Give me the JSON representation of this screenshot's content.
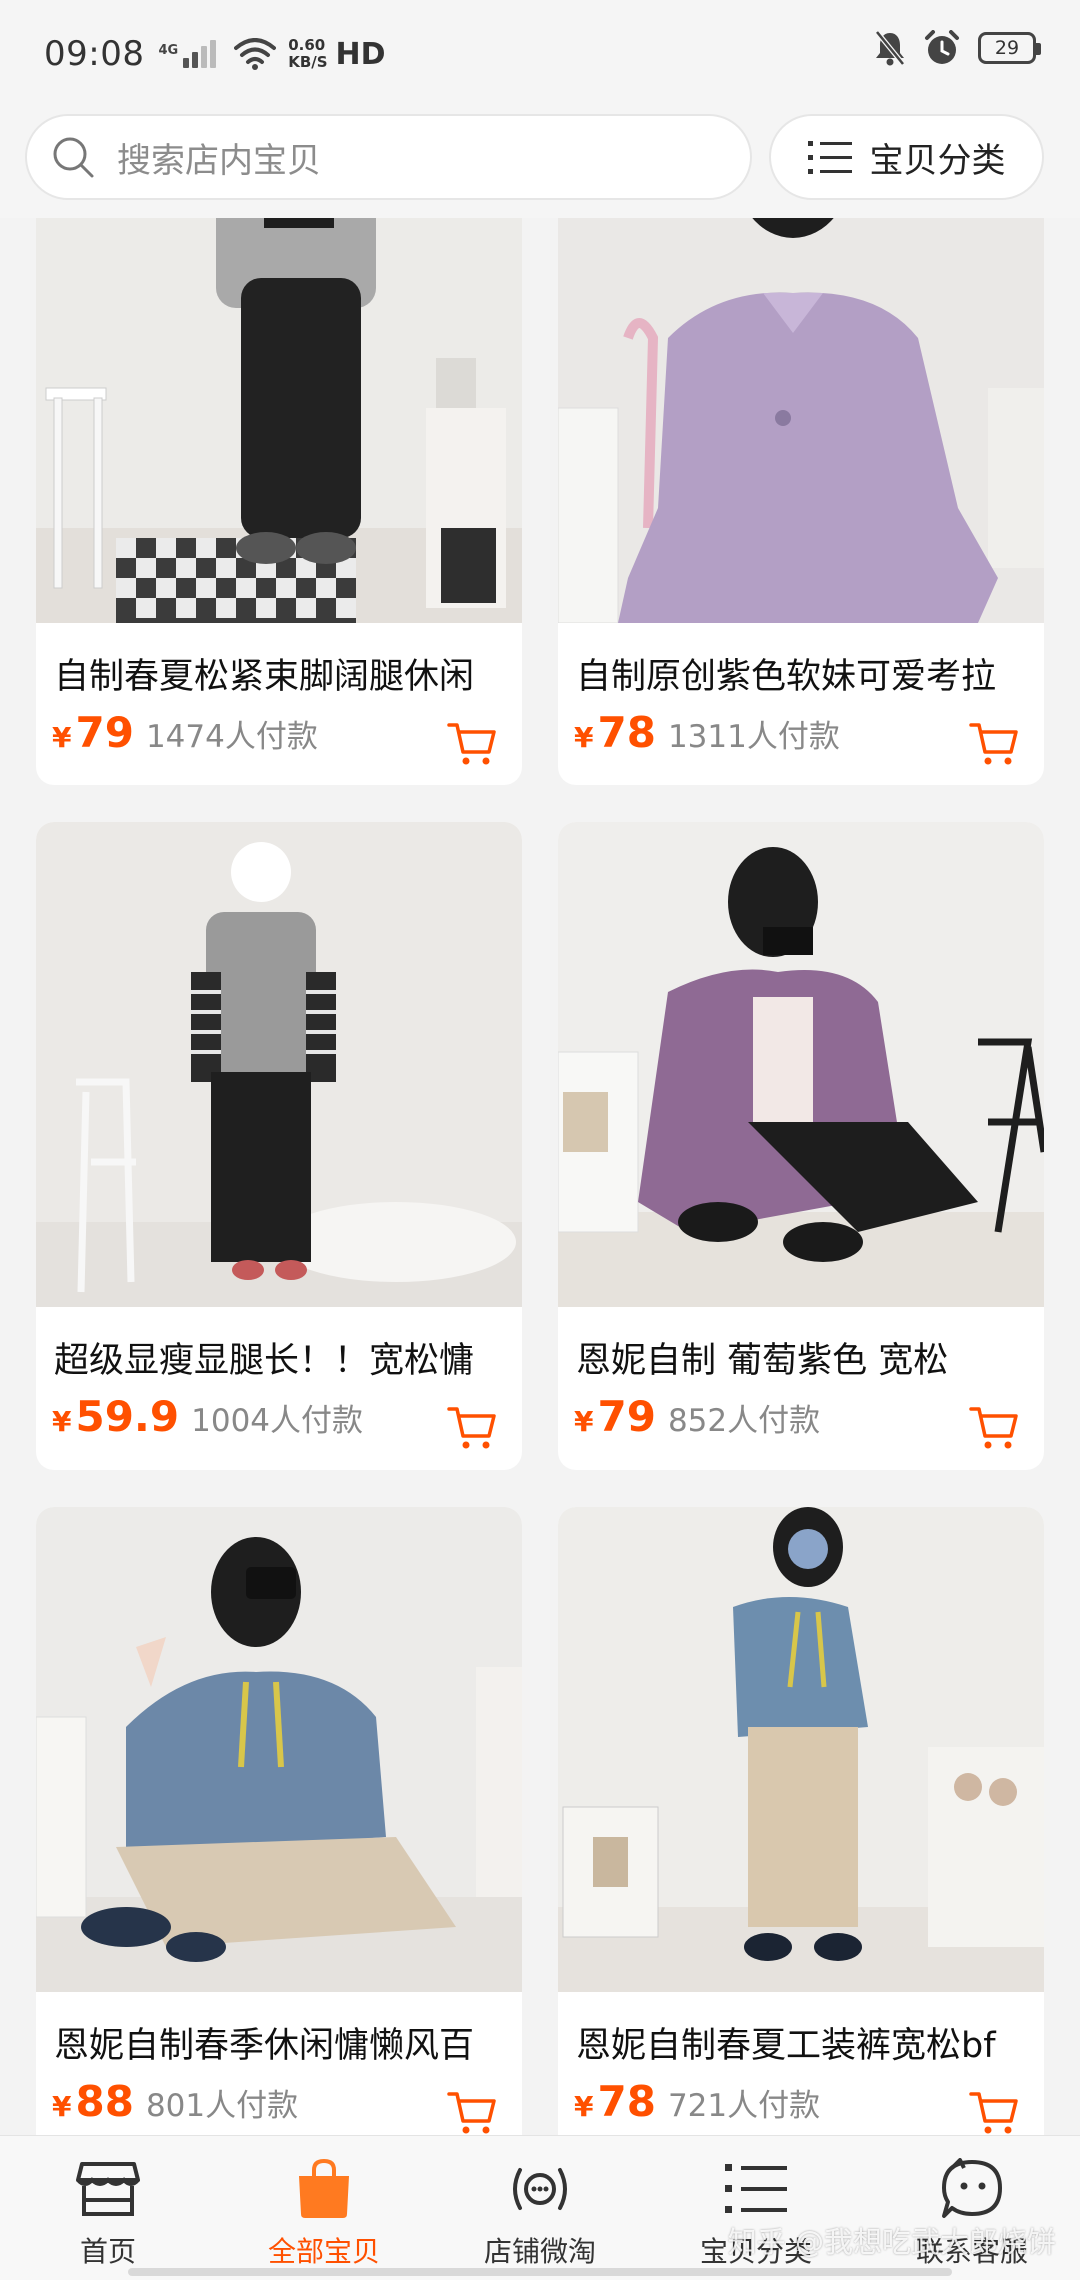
{
  "status_bar": {
    "time": "09:08",
    "network": "4G",
    "speed_value": "0.60",
    "speed_unit": "KB/S",
    "hd": "HD",
    "battery": "29"
  },
  "search": {
    "placeholder": "搜索店内宝贝",
    "category_label": "宝贝分类"
  },
  "accent_color": "#ff5000",
  "products": [
    {
      "title": "自制春夏松紧束脚阔腿休闲",
      "currency": "¥",
      "price": "79",
      "sold": "1474人付款"
    },
    {
      "title": "自制原创紫色软妹可爱考拉",
      "currency": "¥",
      "price": "78",
      "sold": "1311人付款"
    },
    {
      "title": "超级显瘦显腿长！！宽松慵",
      "currency": "¥",
      "price": "59.9",
      "sold": "1004人付款"
    },
    {
      "title": "恩妮自制 葡萄紫色 宽松",
      "currency": "¥",
      "price": "79",
      "sold": "852人付款"
    },
    {
      "title": "恩妮自制春季休闲慵懒风百",
      "currency": "¥",
      "price": "88",
      "sold": "801人付款"
    },
    {
      "title": "恩妮自制春夏工装裤宽松bf",
      "currency": "¥",
      "price": "78",
      "sold": "721人付款"
    }
  ],
  "tabs": [
    {
      "label": "首页",
      "icon": "storefront-icon",
      "active": false
    },
    {
      "label": "全部宝贝",
      "icon": "shopping-bag-icon",
      "active": true
    },
    {
      "label": "店铺微淘",
      "icon": "broadcast-icon",
      "active": false
    },
    {
      "label": "宝贝分类",
      "icon": "category-list-icon",
      "active": false
    },
    {
      "label": "联系客服",
      "icon": "service-chat-icon",
      "active": false
    }
  ],
  "watermark": "知乎 @我想吃武大郎烧饼"
}
